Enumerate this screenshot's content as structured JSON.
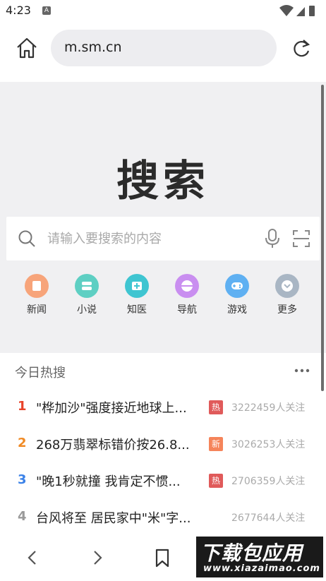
{
  "status": {
    "time": "4:23",
    "notif_badge": "A"
  },
  "toolbar": {
    "url": "m.sm.cn"
  },
  "page": {
    "logo": "搜索",
    "search_placeholder": "请输入要搜索的内容",
    "shortcuts": [
      {
        "label": "新闻",
        "color": "#f7a47a",
        "icon": "news-icon"
      },
      {
        "label": "小说",
        "color": "#5ecfc3",
        "icon": "novel-icon"
      },
      {
        "label": "知医",
        "color": "#3fc5d1",
        "icon": "medical-icon"
      },
      {
        "label": "导航",
        "color": "#c98ef0",
        "icon": "navigation-icon"
      },
      {
        "label": "游戏",
        "color": "#5fb0f2",
        "icon": "gamepad-icon"
      },
      {
        "label": "更多",
        "color": "#a9b6c4",
        "icon": "more-icon"
      }
    ],
    "hot": {
      "title": "今日热搜",
      "items": [
        {
          "rank": "1",
          "rank_color": "#e8432a",
          "text": "\"桦加沙\"强度接近地球上...",
          "tag": "热",
          "tag_color": "#e05a5a",
          "count": "3222459人关注"
        },
        {
          "rank": "2",
          "rank_color": "#f08a24",
          "text": "268万翡翠标错价按26.8...",
          "tag": "新",
          "tag_color": "#f5845a",
          "count": "3026253人关注"
        },
        {
          "rank": "3",
          "rank_color": "#3b82e8",
          "text": "\"晚1秒就撞 我肯定不惯...",
          "tag": "热",
          "tag_color": "#e05a5a",
          "count": "2706359人关注"
        },
        {
          "rank": "4",
          "rank_color": "#9a9a9a",
          "text": "台风将至 居民家中\"米\"字...",
          "tag": "",
          "tag_color": "",
          "count": "2677644人关注"
        }
      ]
    }
  },
  "watermark": {
    "main": "下载包应用",
    "sub": "www.xiazaimao.com"
  }
}
